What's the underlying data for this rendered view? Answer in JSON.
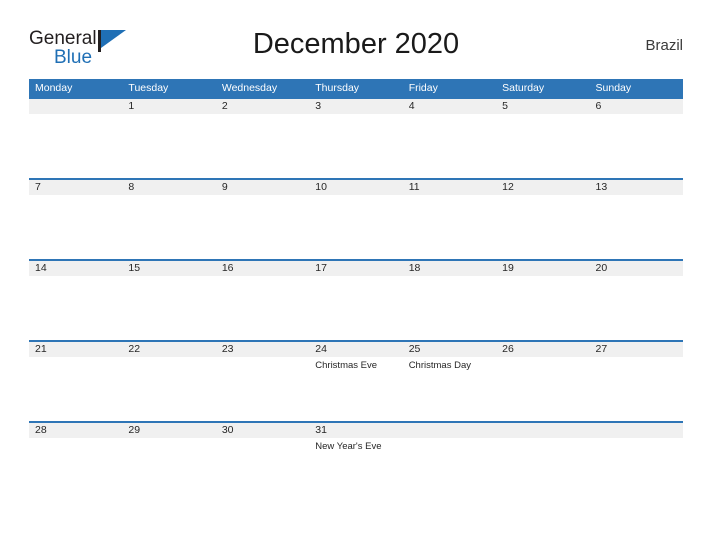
{
  "brand": {
    "name_part1": "General",
    "name_part2": "Blue",
    "flag_icon": "flag-triangle-icon",
    "color_primary": "#1f6fb5",
    "color_dark": "#231f20"
  },
  "header": {
    "title": "December 2020",
    "country": "Brazil"
  },
  "colors": {
    "header_blue": "#2e75b6",
    "band_gray": "#f0f0f0",
    "text_dark": "#262626",
    "page_bg": "#ffffff"
  },
  "calendar": {
    "month": "December",
    "year": "2020",
    "weekday_headers": [
      "Monday",
      "Tuesday",
      "Wednesday",
      "Thursday",
      "Friday",
      "Saturday",
      "Sunday"
    ],
    "weeks": [
      {
        "days": [
          {
            "num": "",
            "event": ""
          },
          {
            "num": "1",
            "event": ""
          },
          {
            "num": "2",
            "event": ""
          },
          {
            "num": "3",
            "event": ""
          },
          {
            "num": "4",
            "event": ""
          },
          {
            "num": "5",
            "event": ""
          },
          {
            "num": "6",
            "event": ""
          }
        ]
      },
      {
        "days": [
          {
            "num": "7",
            "event": ""
          },
          {
            "num": "8",
            "event": ""
          },
          {
            "num": "9",
            "event": ""
          },
          {
            "num": "10",
            "event": ""
          },
          {
            "num": "11",
            "event": ""
          },
          {
            "num": "12",
            "event": ""
          },
          {
            "num": "13",
            "event": ""
          }
        ]
      },
      {
        "days": [
          {
            "num": "14",
            "event": ""
          },
          {
            "num": "15",
            "event": ""
          },
          {
            "num": "16",
            "event": ""
          },
          {
            "num": "17",
            "event": ""
          },
          {
            "num": "18",
            "event": ""
          },
          {
            "num": "19",
            "event": ""
          },
          {
            "num": "20",
            "event": ""
          }
        ]
      },
      {
        "days": [
          {
            "num": "21",
            "event": ""
          },
          {
            "num": "22",
            "event": ""
          },
          {
            "num": "23",
            "event": ""
          },
          {
            "num": "24",
            "event": "Christmas Eve"
          },
          {
            "num": "25",
            "event": "Christmas Day"
          },
          {
            "num": "26",
            "event": ""
          },
          {
            "num": "27",
            "event": ""
          }
        ]
      },
      {
        "days": [
          {
            "num": "28",
            "event": ""
          },
          {
            "num": "29",
            "event": ""
          },
          {
            "num": "30",
            "event": ""
          },
          {
            "num": "31",
            "event": "New Year's Eve"
          },
          {
            "num": "",
            "event": ""
          },
          {
            "num": "",
            "event": ""
          },
          {
            "num": "",
            "event": ""
          }
        ]
      }
    ]
  }
}
